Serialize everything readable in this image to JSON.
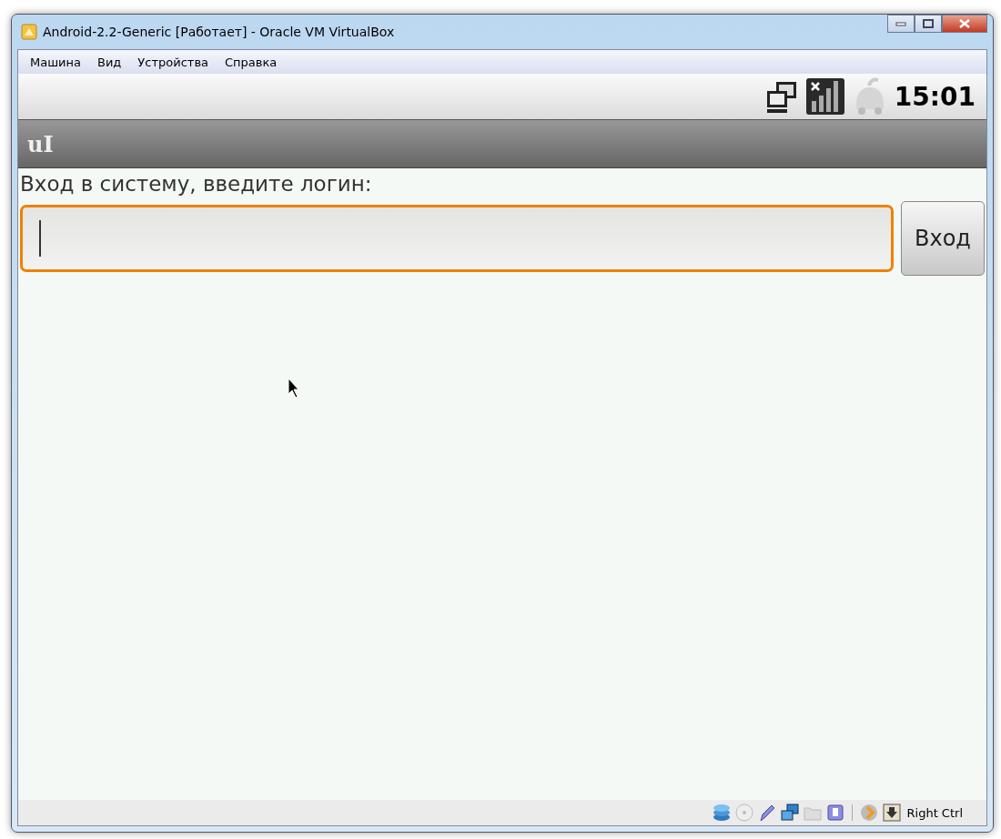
{
  "window": {
    "title": "Android-2.2-Generic [Работает] - Oracle VM VirtualBox"
  },
  "menu": [
    "Машина",
    "Вид",
    "Устройства",
    "Справка"
  ],
  "android_status_bar": {
    "time": "15:01"
  },
  "app_title": "uI",
  "prompt": "Вход в систему, введите логин:",
  "login_field": {
    "focused": true
  },
  "login_button": "Вход",
  "host_key": "Right Ctrl"
}
